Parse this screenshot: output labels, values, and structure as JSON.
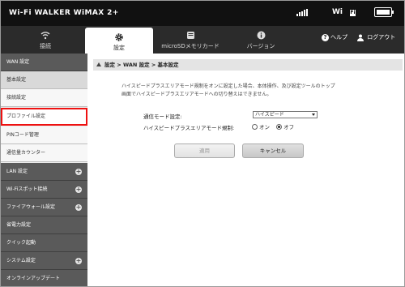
{
  "header": {
    "brand": "Wi-Fi WALKER WiMAX 2+",
    "wifi_label": "Wi",
    "wifi_badge": "Fi",
    "icons": [
      "signal-icon",
      "battery-icon"
    ]
  },
  "nav": {
    "tabs": [
      {
        "label": "接続",
        "icon": "wifi-icon"
      },
      {
        "label": "設定",
        "icon": "gear-icon"
      },
      {
        "label": "microSDメモリカード",
        "icon": "sd-card-icon"
      },
      {
        "label": "バージョン",
        "icon": "info-icon"
      }
    ],
    "help": "ヘルプ",
    "logout": "ログアウト"
  },
  "sidebar": {
    "items": [
      {
        "label": "WAN 設定"
      },
      {
        "label": "基本設定"
      },
      {
        "label": "接続設定"
      },
      {
        "label": "プロファイル設定"
      },
      {
        "label": "PINコード管理"
      },
      {
        "label": "通信量カウンター"
      },
      {
        "label": "LAN 設定"
      },
      {
        "label": "Wi-Fiスポット接続"
      },
      {
        "label": "ファイアウォール設定"
      },
      {
        "label": "省電力設定"
      },
      {
        "label": "クイック起動"
      },
      {
        "label": "システム設定"
      },
      {
        "label": "オンラインアップデート"
      }
    ]
  },
  "main": {
    "breadcrumb": "設定 > WAN 設定 > 基本設定",
    "notice_line1": "ハイスピードプラスエリアモード規制をオンに設定した場合、本体操作、及び設定ツールのトップ",
    "notice_line2": "画面でハイスピードプラスエリアモードへの切り替えはできません。",
    "mode_label": "通信モード設定:",
    "mode_value": "ハイスピード",
    "restrict_label": "ハイスピードプラスエリアモード規制:",
    "radio_on": "オン",
    "radio_off": "オフ",
    "apply_button": "適用",
    "cancel_button": "キャンセル"
  }
}
